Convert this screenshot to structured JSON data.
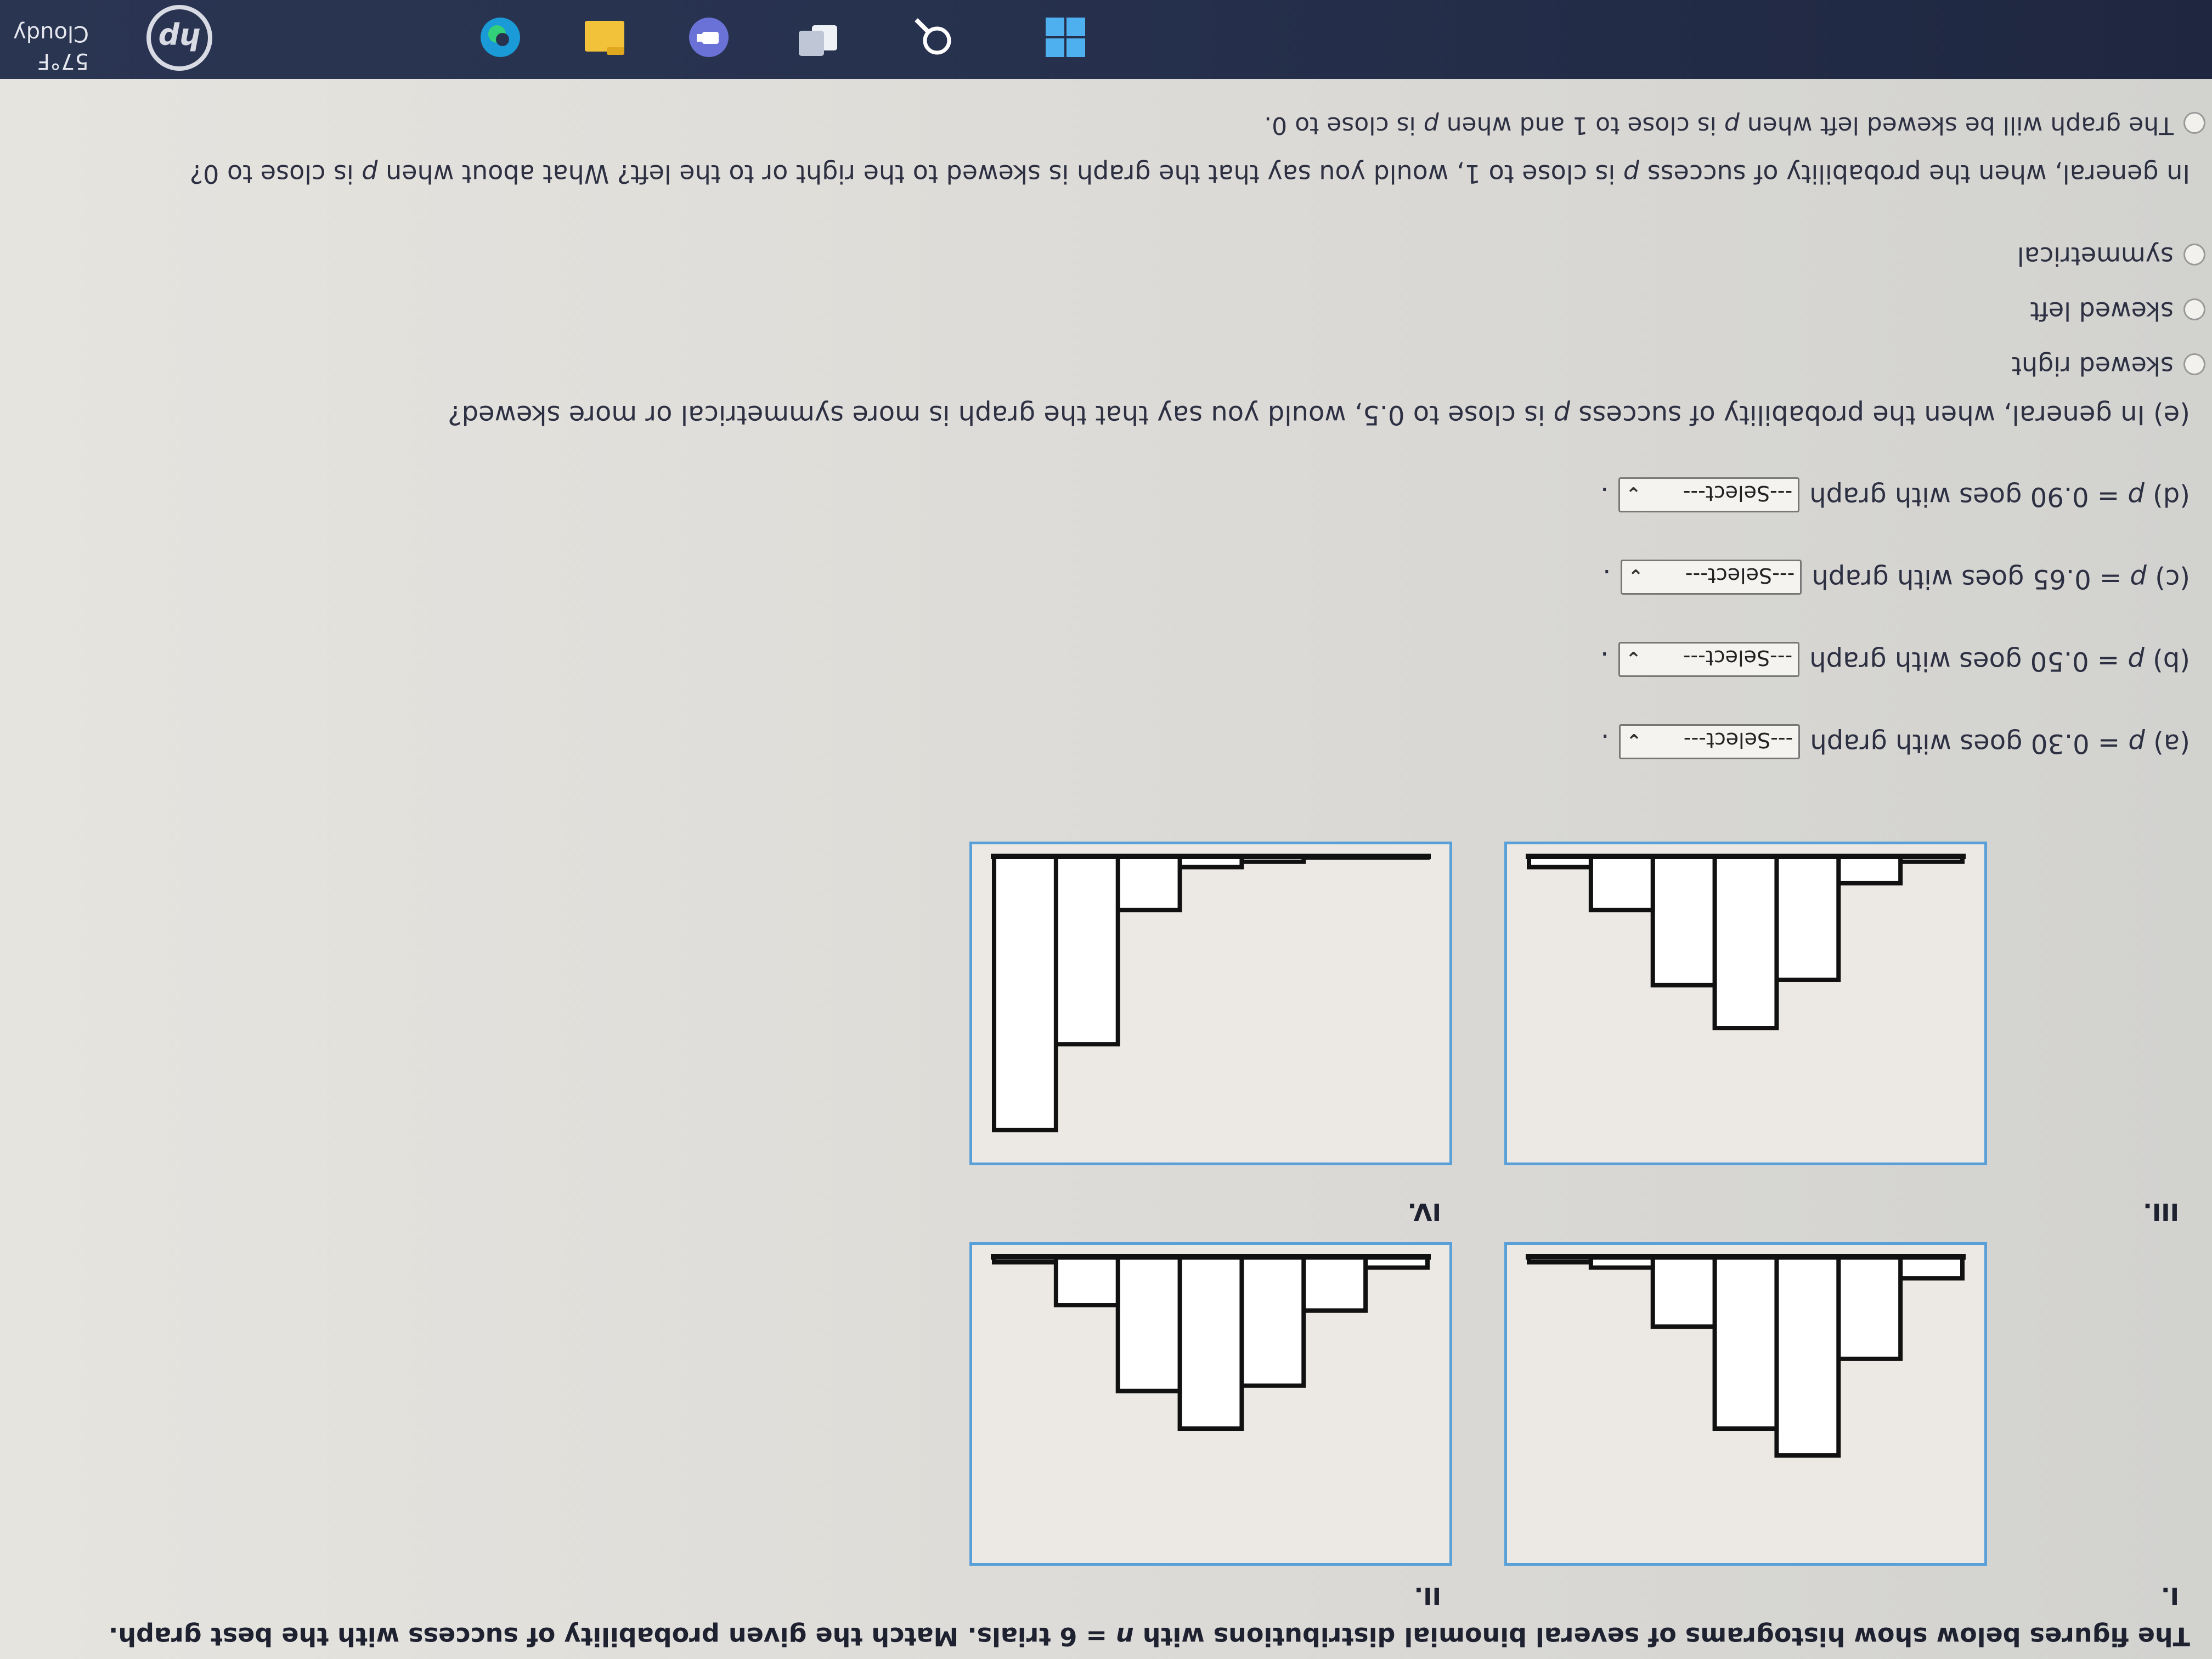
{
  "intro": {
    "text_before": "The figures below show histograms of several binomial distributions with ",
    "n_expr": "n",
    "text_after": " = 6 trials. Match the given probability of success with the best graph."
  },
  "graphs": [
    {
      "label": "I.",
      "bars": [
        0.04,
        0.19,
        0.37,
        0.32,
        0.13,
        0.02,
        0.01
      ]
    },
    {
      "label": "II.",
      "bars": [
        0.02,
        0.1,
        0.24,
        0.32,
        0.25,
        0.09,
        0.01
      ]
    },
    {
      "label": "III.",
      "bars": [
        0.01,
        0.05,
        0.23,
        0.32,
        0.24,
        0.1,
        0.02
      ]
    },
    {
      "label": "IV.",
      "bars": [
        0.0,
        0.0,
        0.01,
        0.02,
        0.1,
        0.35,
        0.51
      ]
    }
  ],
  "questions": [
    {
      "prefix": "(a) ",
      "p": "p",
      "suffix": " = 0.30 goes with graph",
      "select": "---Select---",
      "end": "."
    },
    {
      "prefix": "(b) ",
      "p": "p",
      "suffix": " = 0.50 goes with graph",
      "select": "---Select---",
      "end": "."
    },
    {
      "prefix": "(c) ",
      "p": "p",
      "suffix": " = 0.65 goes with graph",
      "select": "---Select---",
      "end": "."
    },
    {
      "prefix": "(d) ",
      "p": "p",
      "suffix": " = 0.90 goes with graph",
      "select": "---Select---",
      "end": "."
    }
  ],
  "part_e": {
    "text_before": "(e) In general, when the probability of success ",
    "p": "p",
    "text_after": " is close to 0.5, would you say that the graph is more symmetrical or more skewed?",
    "options": [
      "skewed right",
      "skewed left",
      "symmetrical"
    ]
  },
  "part_f": {
    "text_1": "In general, when the probability of success ",
    "p": "p",
    "text_2": " is close to 1, would you say that the graph is skewed to the right or to the left? What about when ",
    "p2": "p",
    "text_3": " is close to 0?",
    "option_1a": "The graph will be skewed left when ",
    "option_1b": " is close to 1 and when ",
    "option_1c": " is close to 0."
  },
  "taskbar": {
    "temperature": "57°F",
    "weather": "Cloudy"
  },
  "colors": {
    "graph_border": "#5aa0d8",
    "taskbar": "#1f2740"
  }
}
